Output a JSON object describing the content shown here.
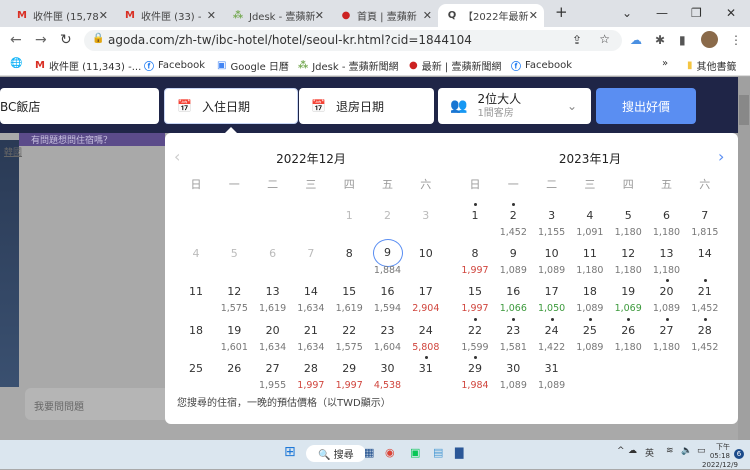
{
  "browser": {
    "tabs": [
      {
        "label": "收件匣 (15,78",
        "icon": "gmail-icon"
      },
      {
        "label": "收件匣 (33) -",
        "icon": "gmail-icon"
      },
      {
        "label": "Jdesk - 壹蘋新",
        "icon": "jdesk-icon"
      },
      {
        "label": "首頁 | 壹蘋新",
        "icon": "apple-news-icon"
      },
      {
        "label": "【2022年最新",
        "icon": "agoda-icon",
        "active": true
      }
    ],
    "url": "agoda.com/zh-tw/ibc-hotel/hotel/seoul-kr.html?cid=1844104",
    "bookmarks": [
      {
        "label": "收件匣 (11,343) -...",
        "icon": "gmail-icon"
      },
      {
        "label": "Facebook",
        "icon": "facebook-icon"
      },
      {
        "label": "Google 日曆",
        "icon": "calendar-icon"
      },
      {
        "label": "Jdesk - 壹蘋新聞網",
        "icon": "jdesk-icon"
      },
      {
        "label": "最新 | 壹蘋新聞網",
        "icon": "apple-news-icon"
      },
      {
        "label": "Facebook",
        "icon": "facebook-icon"
      }
    ],
    "other_bookmarks": "其他書籤"
  },
  "search": {
    "hotel": "BC飯店",
    "checkin": "入住日期",
    "checkout": "退房日期",
    "guests": "2位大人",
    "rooms": "1間客房",
    "button": "搜出好價"
  },
  "left": {
    "banner": "有問題想問住宿嗎？",
    "link": "韓國",
    "ask": "我要問問題"
  },
  "calendar": {
    "weekdays": [
      "日",
      "一",
      "二",
      "三",
      "四",
      "五",
      "六"
    ],
    "note": "您搜尋的住宿，一晚的預估價格（以TWD顯示）",
    "colors": {
      "selected": "#5a8ef2",
      "high": "#d0453d",
      "low": "#3d9a3d"
    },
    "months": [
      {
        "title": "2022年12月",
        "year": 2022,
        "month": 12,
        "days": [
          {
            "d": "1",
            "disabled": true
          },
          {
            "d": "2",
            "disabled": true
          },
          {
            "d": "3",
            "disabled": true
          },
          {
            "d": "4",
            "disabled": true
          },
          {
            "d": "5",
            "disabled": true
          },
          {
            "d": "6",
            "disabled": true
          },
          {
            "d": "7",
            "disabled": true
          },
          {
            "d": "8"
          },
          {
            "d": "9",
            "p": "1,884",
            "selected": true
          },
          {
            "d": "10"
          },
          {
            "d": "11"
          },
          {
            "d": "12",
            "p": "1,575"
          },
          {
            "d": "13",
            "p": "1,619"
          },
          {
            "d": "14",
            "p": "1,634"
          },
          {
            "d": "15",
            "p": "1,619"
          },
          {
            "d": "16",
            "p": "1,594"
          },
          {
            "d": "17",
            "p": "2,904",
            "tone": "red"
          },
          {
            "d": "18"
          },
          {
            "d": "19",
            "p": "1,601"
          },
          {
            "d": "20",
            "p": "1,634"
          },
          {
            "d": "21",
            "p": "1,634"
          },
          {
            "d": "22",
            "p": "1,575"
          },
          {
            "d": "23",
            "p": "1,604"
          },
          {
            "d": "24",
            "p": "5,808",
            "tone": "red"
          },
          {
            "d": "25"
          },
          {
            "d": "26"
          },
          {
            "d": "27",
            "p": "1,955"
          },
          {
            "d": "28",
            "p": "1,997",
            "tone": "red"
          },
          {
            "d": "29",
            "p": "1,997",
            "tone": "red"
          },
          {
            "d": "30",
            "p": "4,538",
            "tone": "red"
          },
          {
            "d": "31",
            "dot": true
          }
        ]
      },
      {
        "title": "2023年1月",
        "year": 2023,
        "month": 1,
        "days": [
          {
            "d": "1",
            "dot": true
          },
          {
            "d": "2",
            "p": "1,452",
            "dot": true
          },
          {
            "d": "3",
            "p": "1,155"
          },
          {
            "d": "4",
            "p": "1,091"
          },
          {
            "d": "5",
            "p": "1,180"
          },
          {
            "d": "6",
            "p": "1,180"
          },
          {
            "d": "7",
            "p": "1,815"
          },
          {
            "d": "8",
            "p": "1,997",
            "tone": "red"
          },
          {
            "d": "9",
            "p": "1,089"
          },
          {
            "d": "10",
            "p": "1,089"
          },
          {
            "d": "11",
            "p": "1,180"
          },
          {
            "d": "12",
            "p": "1,180"
          },
          {
            "d": "13",
            "p": "1,180"
          },
          {
            "d": "14"
          },
          {
            "d": "15",
            "p": "1,997",
            "tone": "red"
          },
          {
            "d": "16",
            "p": "1,066",
            "tone": "green"
          },
          {
            "d": "17",
            "p": "1,050",
            "tone": "green"
          },
          {
            "d": "18",
            "p": "1,089"
          },
          {
            "d": "19",
            "p": "1,069",
            "tone": "green"
          },
          {
            "d": "20",
            "p": "1,089",
            "dot": true
          },
          {
            "d": "21",
            "p": "1,452",
            "dot": true
          },
          {
            "d": "22",
            "p": "1,599",
            "dot": true
          },
          {
            "d": "23",
            "p": "1,581",
            "dot": true
          },
          {
            "d": "24",
            "p": "1,422",
            "dot": true
          },
          {
            "d": "25",
            "p": "1,089",
            "dot": true
          },
          {
            "d": "26",
            "p": "1,180",
            "dot": true
          },
          {
            "d": "27",
            "p": "1,180",
            "dot": true
          },
          {
            "d": "28",
            "p": "1,452",
            "dot": true
          },
          {
            "d": "29",
            "p": "1,984",
            "tone": "red",
            "dot": true
          },
          {
            "d": "30",
            "p": "1,089"
          },
          {
            "d": "31",
            "p": "1,089"
          }
        ]
      }
    ]
  },
  "taskbar": {
    "search": "搜尋",
    "lang": "英",
    "time": "下午 05:18",
    "date": "2022/12/9",
    "badge": "6"
  }
}
